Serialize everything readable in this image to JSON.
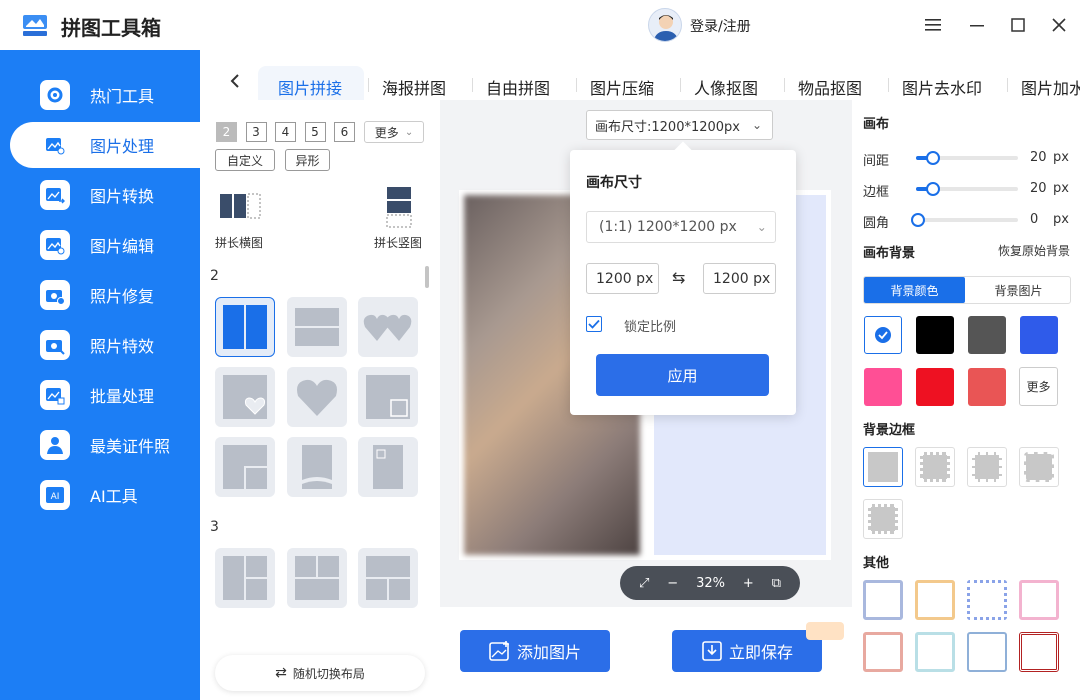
{
  "app": {
    "title": "拼图工具箱",
    "login": "登录/注册"
  },
  "sidebar": {
    "items": [
      {
        "label": "热门工具",
        "icon": "gear-icon"
      },
      {
        "label": "图片处理",
        "icon": "image-edit-icon"
      },
      {
        "label": "图片转换",
        "icon": "image-convert-icon"
      },
      {
        "label": "图片编辑",
        "icon": "image-edit-icon"
      },
      {
        "label": "照片修复",
        "icon": "camera-plus-icon"
      },
      {
        "label": "照片特效",
        "icon": "camera-magic-icon"
      },
      {
        "label": "批量处理",
        "icon": "batch-icon"
      },
      {
        "label": "最美证件照",
        "icon": "person-id-icon"
      },
      {
        "label": "AI工具",
        "icon": "ai-icon"
      }
    ],
    "active_index": 1
  },
  "tabs": [
    "图片拼接",
    "海报拼图",
    "自由拼图",
    "图片压缩",
    "人像抠图",
    "物品抠图",
    "图片去水印",
    "图片加水"
  ],
  "left": {
    "counts": [
      "2",
      "3",
      "4",
      "5",
      "6"
    ],
    "more": "更多",
    "custom": "自定义",
    "special": "异形",
    "long_horizontal": "拼长横图",
    "long_vertical": "拼长竖图",
    "section2": "2",
    "section3": "3",
    "random": "随机切换布局"
  },
  "canvas": {
    "size_select": "画布尺寸:1200*1200px",
    "zoom": "32%",
    "add_image": "添加图片",
    "save": "立即保存"
  },
  "popup": {
    "title": "画布尺寸",
    "preset": "(1:1) 1200*1200 px",
    "width": "1200 px",
    "height": "1200 px",
    "lock": "锁定比例",
    "apply": "应用"
  },
  "right": {
    "canvas_title": "画布",
    "sliders": [
      {
        "label": "间距",
        "value": "20",
        "unit": "px",
        "fraction": 0.15
      },
      {
        "label": "边框",
        "value": "20",
        "unit": "px",
        "fraction": 0.15
      },
      {
        "label": "圆角",
        "value": "0",
        "unit": "px",
        "fraction": 0.0
      }
    ],
    "bg_title": "画布背景",
    "restore": "恢复原始背景",
    "bg_tabs": [
      "背景颜色",
      "背景图片"
    ],
    "colors": [
      "#ffffff",
      "#000000",
      "#555555",
      "#2f5bea",
      "#ff4f95",
      "#ee1122",
      "#e95555"
    ],
    "more": "更多",
    "border_title": "背景边框",
    "other_title": "其他"
  },
  "colors": {
    "accent": "#1a6fe8",
    "sidebar": "#1c7ef5"
  }
}
